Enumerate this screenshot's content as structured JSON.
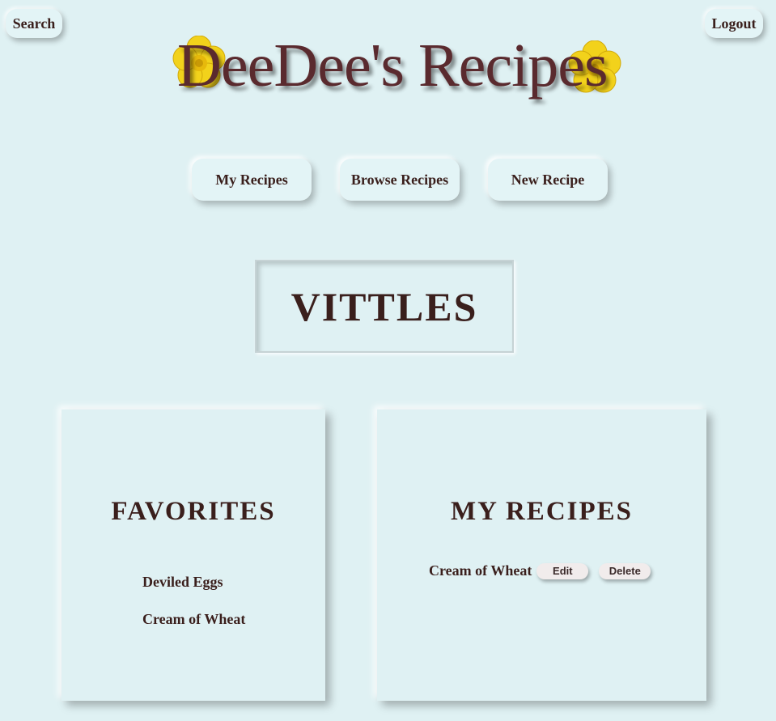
{
  "header": {
    "search_label": "Search",
    "logout_label": "Logout",
    "logo_text": "DeeDee's Recipes"
  },
  "nav": {
    "my_recipes": "My Recipes",
    "browse_recipes": "Browse Recipes",
    "new_recipe": "New Recipe"
  },
  "main": {
    "title": "VITTLES"
  },
  "favorites": {
    "heading": "FAVORITES",
    "items": [
      {
        "label": "Deviled Eggs"
      },
      {
        "label": "Cream of Wheat"
      }
    ]
  },
  "my_recipes": {
    "heading": "MY RECIPES",
    "items": [
      {
        "label": "Cream of Wheat",
        "edit_label": "Edit",
        "delete_label": "Delete"
      }
    ]
  },
  "colors": {
    "background": "#dff1f3",
    "text": "#3a1f1c",
    "logo": "#5a2a2e",
    "flower": "#f2d21b"
  },
  "icons": {
    "logo_flowers": "buttercup-flower-icon"
  }
}
